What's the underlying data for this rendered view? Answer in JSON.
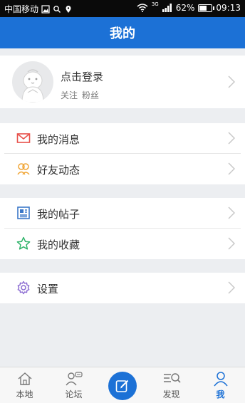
{
  "status_bar": {
    "carrier": "中国移动",
    "battery_percent": "62%",
    "time": "09:13",
    "network": "3G",
    "battery_level": 0.62
  },
  "header": {
    "title": "我的"
  },
  "profile": {
    "login_text": "点击登录",
    "follow_label": "关注",
    "fans_label": "粉丝"
  },
  "menu_group_1": [
    {
      "label": "我的消息",
      "icon": "mail-icon"
    },
    {
      "label": "好友动态",
      "icon": "friends-icon"
    }
  ],
  "menu_group_2": [
    {
      "label": "我的帖子",
      "icon": "posts-icon"
    },
    {
      "label": "我的收藏",
      "icon": "star-icon"
    }
  ],
  "menu_group_3": [
    {
      "label": "设置",
      "icon": "gear-icon"
    }
  ],
  "bottom_nav": [
    {
      "label": "本地",
      "icon": "home-icon"
    },
    {
      "label": "论坛",
      "icon": "forum-icon"
    },
    {
      "label": "",
      "icon": "compose-icon"
    },
    {
      "label": "发现",
      "icon": "discover-icon"
    },
    {
      "label": "我",
      "icon": "profile-icon",
      "active": true
    }
  ],
  "colors": {
    "accent": "#1c71d6",
    "mail": "#e8504a",
    "friends": "#f0a535",
    "posts": "#3b78c8",
    "star": "#2fb36a",
    "gear": "#8a6ad1"
  }
}
